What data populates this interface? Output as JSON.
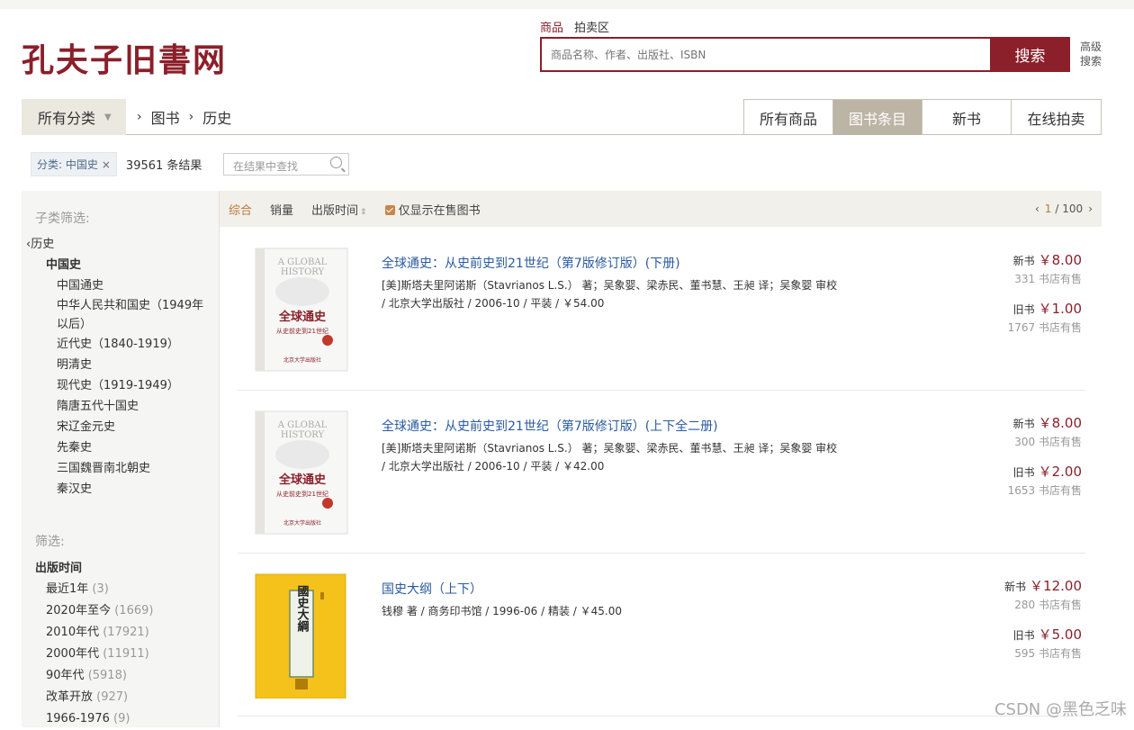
{
  "brand": {
    "logo_text": "孔夫子旧書网",
    "accent": "#8b1f2a"
  },
  "search": {
    "tabs": [
      "商品",
      "拍卖区"
    ],
    "placeholder": "商品名称、作者、出版社、ISBN",
    "button": "搜索",
    "advanced": "高级搜索"
  },
  "category_bar": {
    "all_label": "所有分类",
    "breadcrumb": [
      "图书",
      "历史"
    ],
    "tabs": [
      "所有商品",
      "图书条目",
      "新书",
      "在线拍卖"
    ]
  },
  "filter": {
    "chip_label": "分类: 中国史",
    "chip_close": "×",
    "result_count": "39561 条结果",
    "find_placeholder": "在结果中查找"
  },
  "sidebar": {
    "sub_heading": "子类筛选:",
    "parent": "历史",
    "current": "中国史",
    "items": [
      "中国通史",
      "中华人民共和国史（1949年以后）",
      "近代史（1840-1919）",
      "明清史",
      "现代史（1919-1949）",
      "隋唐五代十国史",
      "宋辽金元史",
      "先秦史",
      "三国魏晋南北朝史",
      "秦汉史"
    ],
    "filter_heading": "筛选:",
    "pub_time_heading": "出版时间",
    "pub_times": [
      {
        "label": "最近1年",
        "count": "(3)"
      },
      {
        "label": "2020年至今",
        "count": "(1669)"
      },
      {
        "label": "2010年代",
        "count": "(17921)"
      },
      {
        "label": "2000年代",
        "count": "(11911)"
      },
      {
        "label": "90年代",
        "count": "(5918)"
      },
      {
        "label": "改革开放",
        "count": "(927)"
      },
      {
        "label": "1966-1976",
        "count": "(9)"
      }
    ]
  },
  "sortbar": {
    "items": [
      "综合",
      "销量",
      "出版时间"
    ],
    "only_on_sale": "仅显示在售图书",
    "page_current": "1",
    "page_total": "/ 100"
  },
  "results": [
    {
      "title": "全球通史：从史前史到21世纪（第7版修订版）(下册)",
      "author_line": "[美]斯塔夫里阿诺斯（Stavrianos L.S.） 著；吴象婴、梁赤民、董书慧、王昶 译；吴象婴 审校",
      "pub_line": "/ 北京大学出版社 / 2006-10 / 平装 / ￥54.00",
      "new_label": "新书",
      "new_price": "￥8.00",
      "new_shops": "331 书店有售",
      "old_label": "旧书",
      "old_price": "￥1.00",
      "old_shops": "1767 书店有售",
      "cover": {
        "line1": "A GLOBAL",
        "line2": "HISTORY",
        "title": "全球通史",
        "sub": "从史前史到21世纪",
        "pub": "北京大学出版社"
      }
    },
    {
      "title": "全球通史：从史前史到21世纪（第7版修订版）(上下全二册)",
      "author_line": "[美]斯塔夫里阿诺斯（Stavrianos L.S.） 著；吴象婴、梁赤民、董书慧、王昶 译；吴象婴 审校",
      "pub_line": "/ 北京大学出版社 / 2006-10 / 平装 / ￥42.00",
      "new_label": "新书",
      "new_price": "￥8.00",
      "new_shops": "300 书店有售",
      "old_label": "旧书",
      "old_price": "￥2.00",
      "old_shops": "1653 书店有售",
      "cover": {
        "line1": "A GLOBAL",
        "line2": "HISTORY",
        "title": "全球通史",
        "sub": "从史前史到21世纪",
        "pub": "北京大学出版社"
      }
    },
    {
      "title": "国史大纲（上下）",
      "author_line": "钱穆 著 / 商务印书馆 / 1996-06 / 精装 / ￥45.00",
      "pub_line": "",
      "new_label": "新书",
      "new_price": "￥12.00",
      "new_shops": "280 书店有售",
      "old_label": "旧书",
      "old_price": "￥5.00",
      "old_shops": "595 书店有售",
      "cover": {
        "title": "國史大綱"
      }
    }
  ],
  "watermark": "CSDN @黑色乏味"
}
